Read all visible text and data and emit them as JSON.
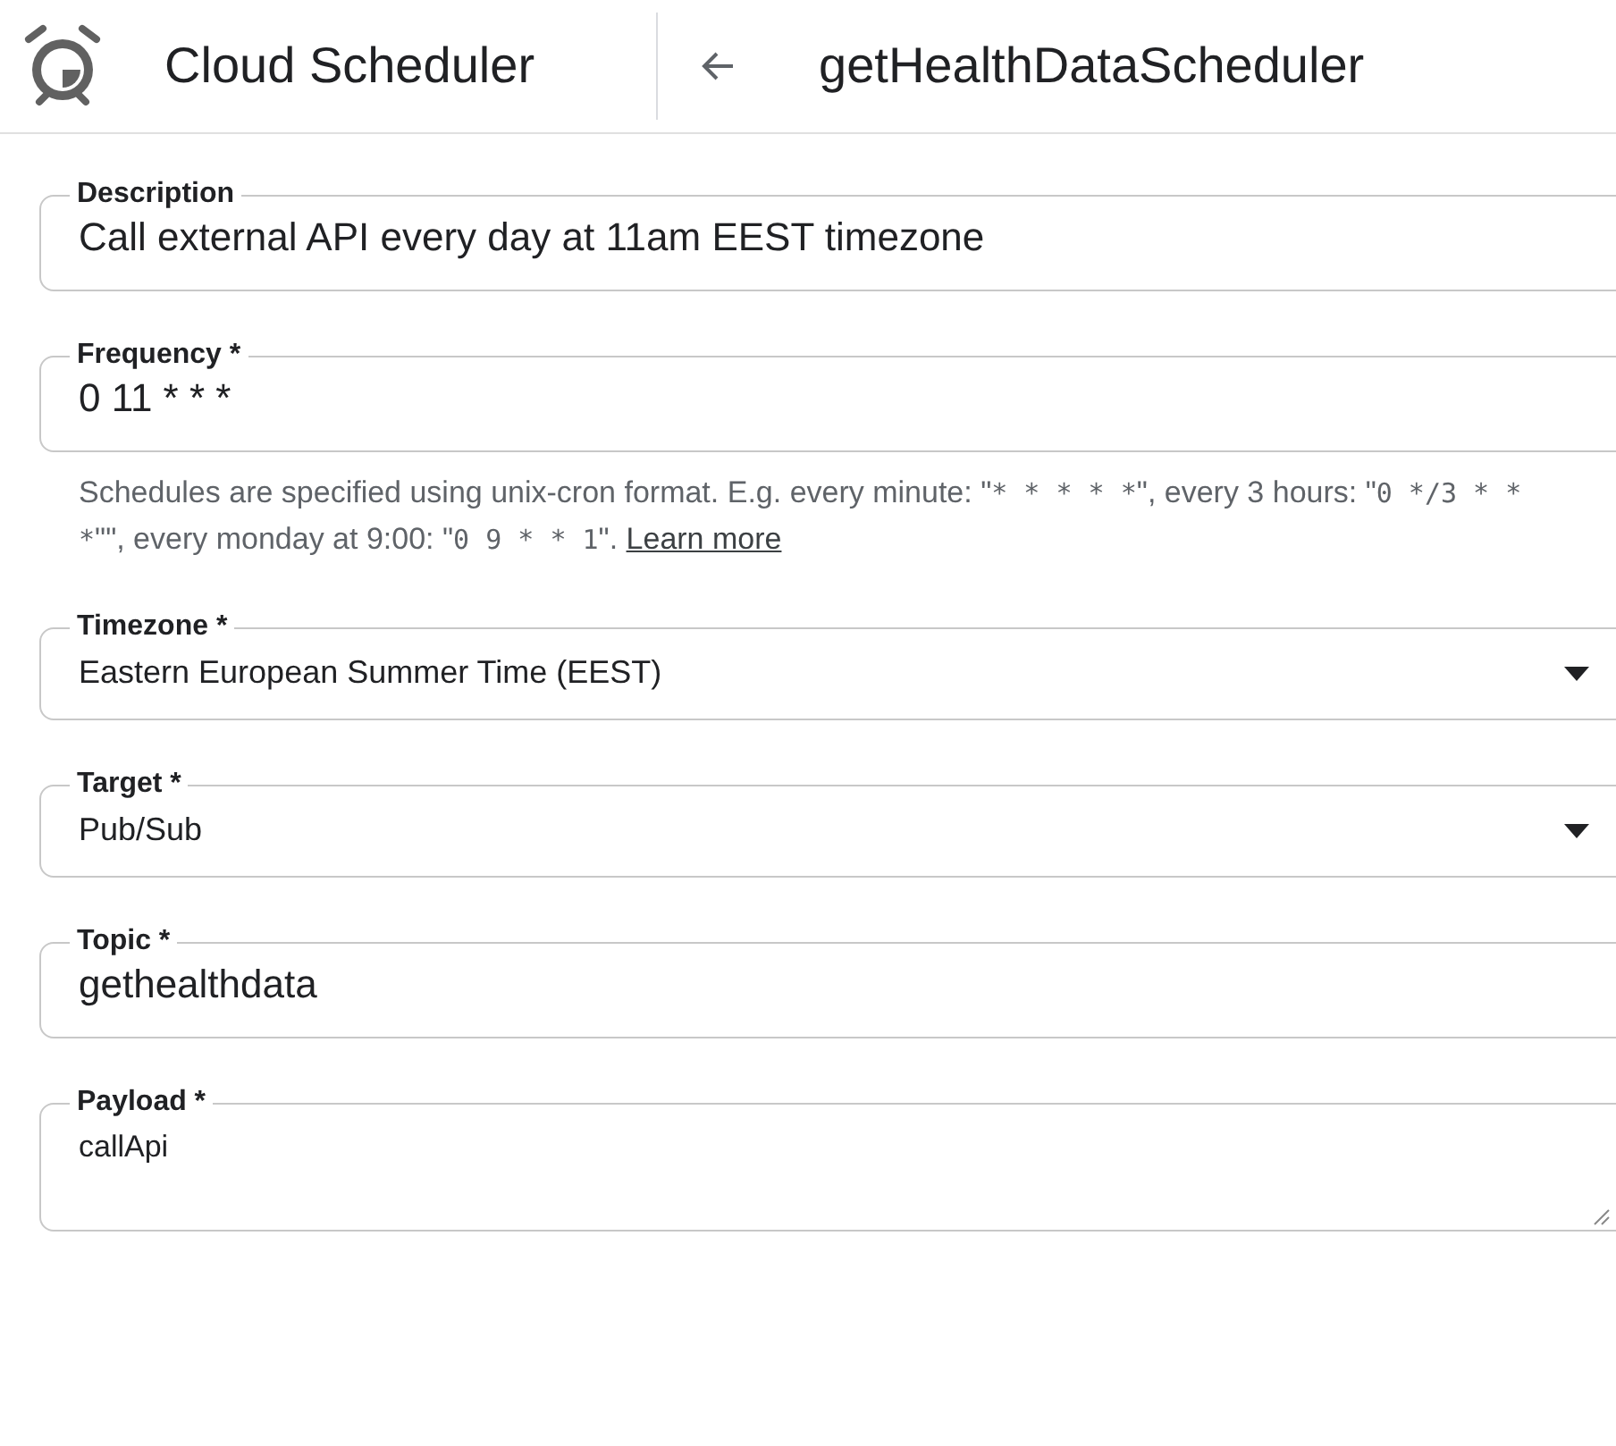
{
  "header": {
    "app_title": "Cloud Scheduler",
    "page_title": "getHealthDataScheduler"
  },
  "fields": [
    {
      "kind": "text",
      "label": "Description",
      "value": "Call external API every day at 11am EEST timezone"
    },
    {
      "kind": "text",
      "label": "Frequency *",
      "value": "0 11 * * *",
      "hint": [
        {
          "kind": "text",
          "text": "Schedules are specified using unix-cron format. E.g. every minute: \""
        },
        {
          "kind": "code",
          "text": "* * * * *"
        },
        {
          "kind": "text",
          "text": "\", every 3 hours: \""
        },
        {
          "kind": "code",
          "text": "0 */3 * * *"
        },
        {
          "kind": "text",
          "text": "\"\", every monday at 9:00: \""
        },
        {
          "kind": "code",
          "text": "0 9 * * 1"
        },
        {
          "kind": "text",
          "text": "\". "
        },
        {
          "kind": "link",
          "text": "Learn more"
        }
      ]
    },
    {
      "kind": "select",
      "label": "Timezone *",
      "value": "Eastern European Summer Time (EEST)"
    },
    {
      "kind": "select",
      "label": "Target *",
      "value": "Pub/Sub"
    },
    {
      "kind": "text",
      "label": "Topic *",
      "value": "gethealthdata"
    },
    {
      "kind": "textarea",
      "label": "Payload *",
      "value": "callApi"
    }
  ]
}
